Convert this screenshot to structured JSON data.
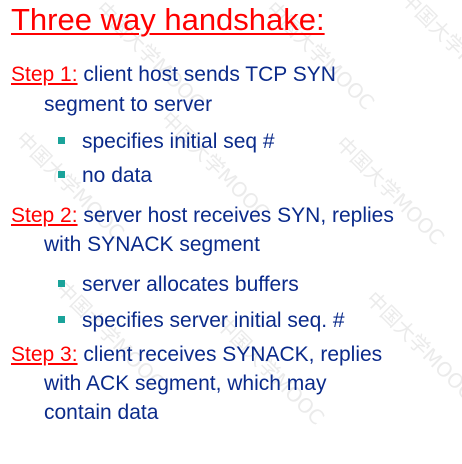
{
  "title": "Three way handshake:",
  "steps": [
    {
      "label": "Step 1:",
      "lines": [
        "client host sends TCP SYN",
        "segment to server"
      ],
      "bullets": [
        "specifies initial seq #",
        "no data"
      ]
    },
    {
      "label": "Step 2:",
      "lines": [
        "server host receives SYN, replies",
        "with SYNACK segment"
      ],
      "bullets": [
        "server allocates buffers",
        "specifies server initial seq. #"
      ]
    },
    {
      "label": "Step 3:",
      "lines": [
        "client receives SYNACK, replies",
        "with ACK segment, which may",
        "contain data"
      ],
      "bullets": []
    }
  ],
  "watermark": "中国大学MOOC",
  "colors": {
    "title": "#ff0000",
    "body_text": "#0a2a8a",
    "bullet": "#1aa39a"
  }
}
